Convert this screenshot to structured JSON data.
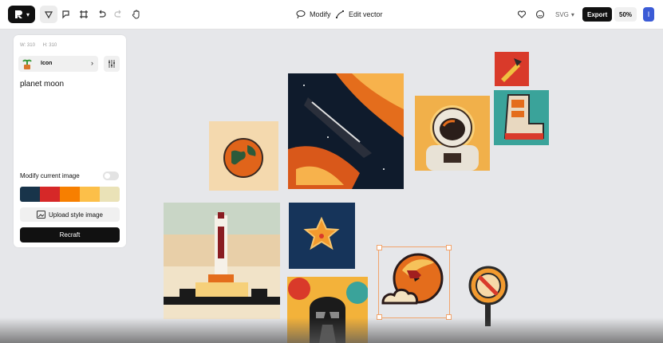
{
  "toolbar": {
    "center_buttons": [
      {
        "label": "Modify",
        "icon": "lasso-icon"
      },
      {
        "label": "Edit vector",
        "icon": "edit-vector-icon"
      }
    ],
    "format": "SVG",
    "export_label": "Export",
    "zoom": "50%",
    "avatar_initial": "I"
  },
  "panel": {
    "width_label": "W: 310",
    "height_label": "H: 310",
    "style_label": "Icon",
    "prompt": "planet moon",
    "modify_label": "Modify current image",
    "palette": [
      "#18344a",
      "#d62828",
      "#f77f00",
      "#fcbf49",
      "#eae2b7"
    ],
    "upload_label": "Upload style image",
    "recraft_label": "Recraft"
  }
}
